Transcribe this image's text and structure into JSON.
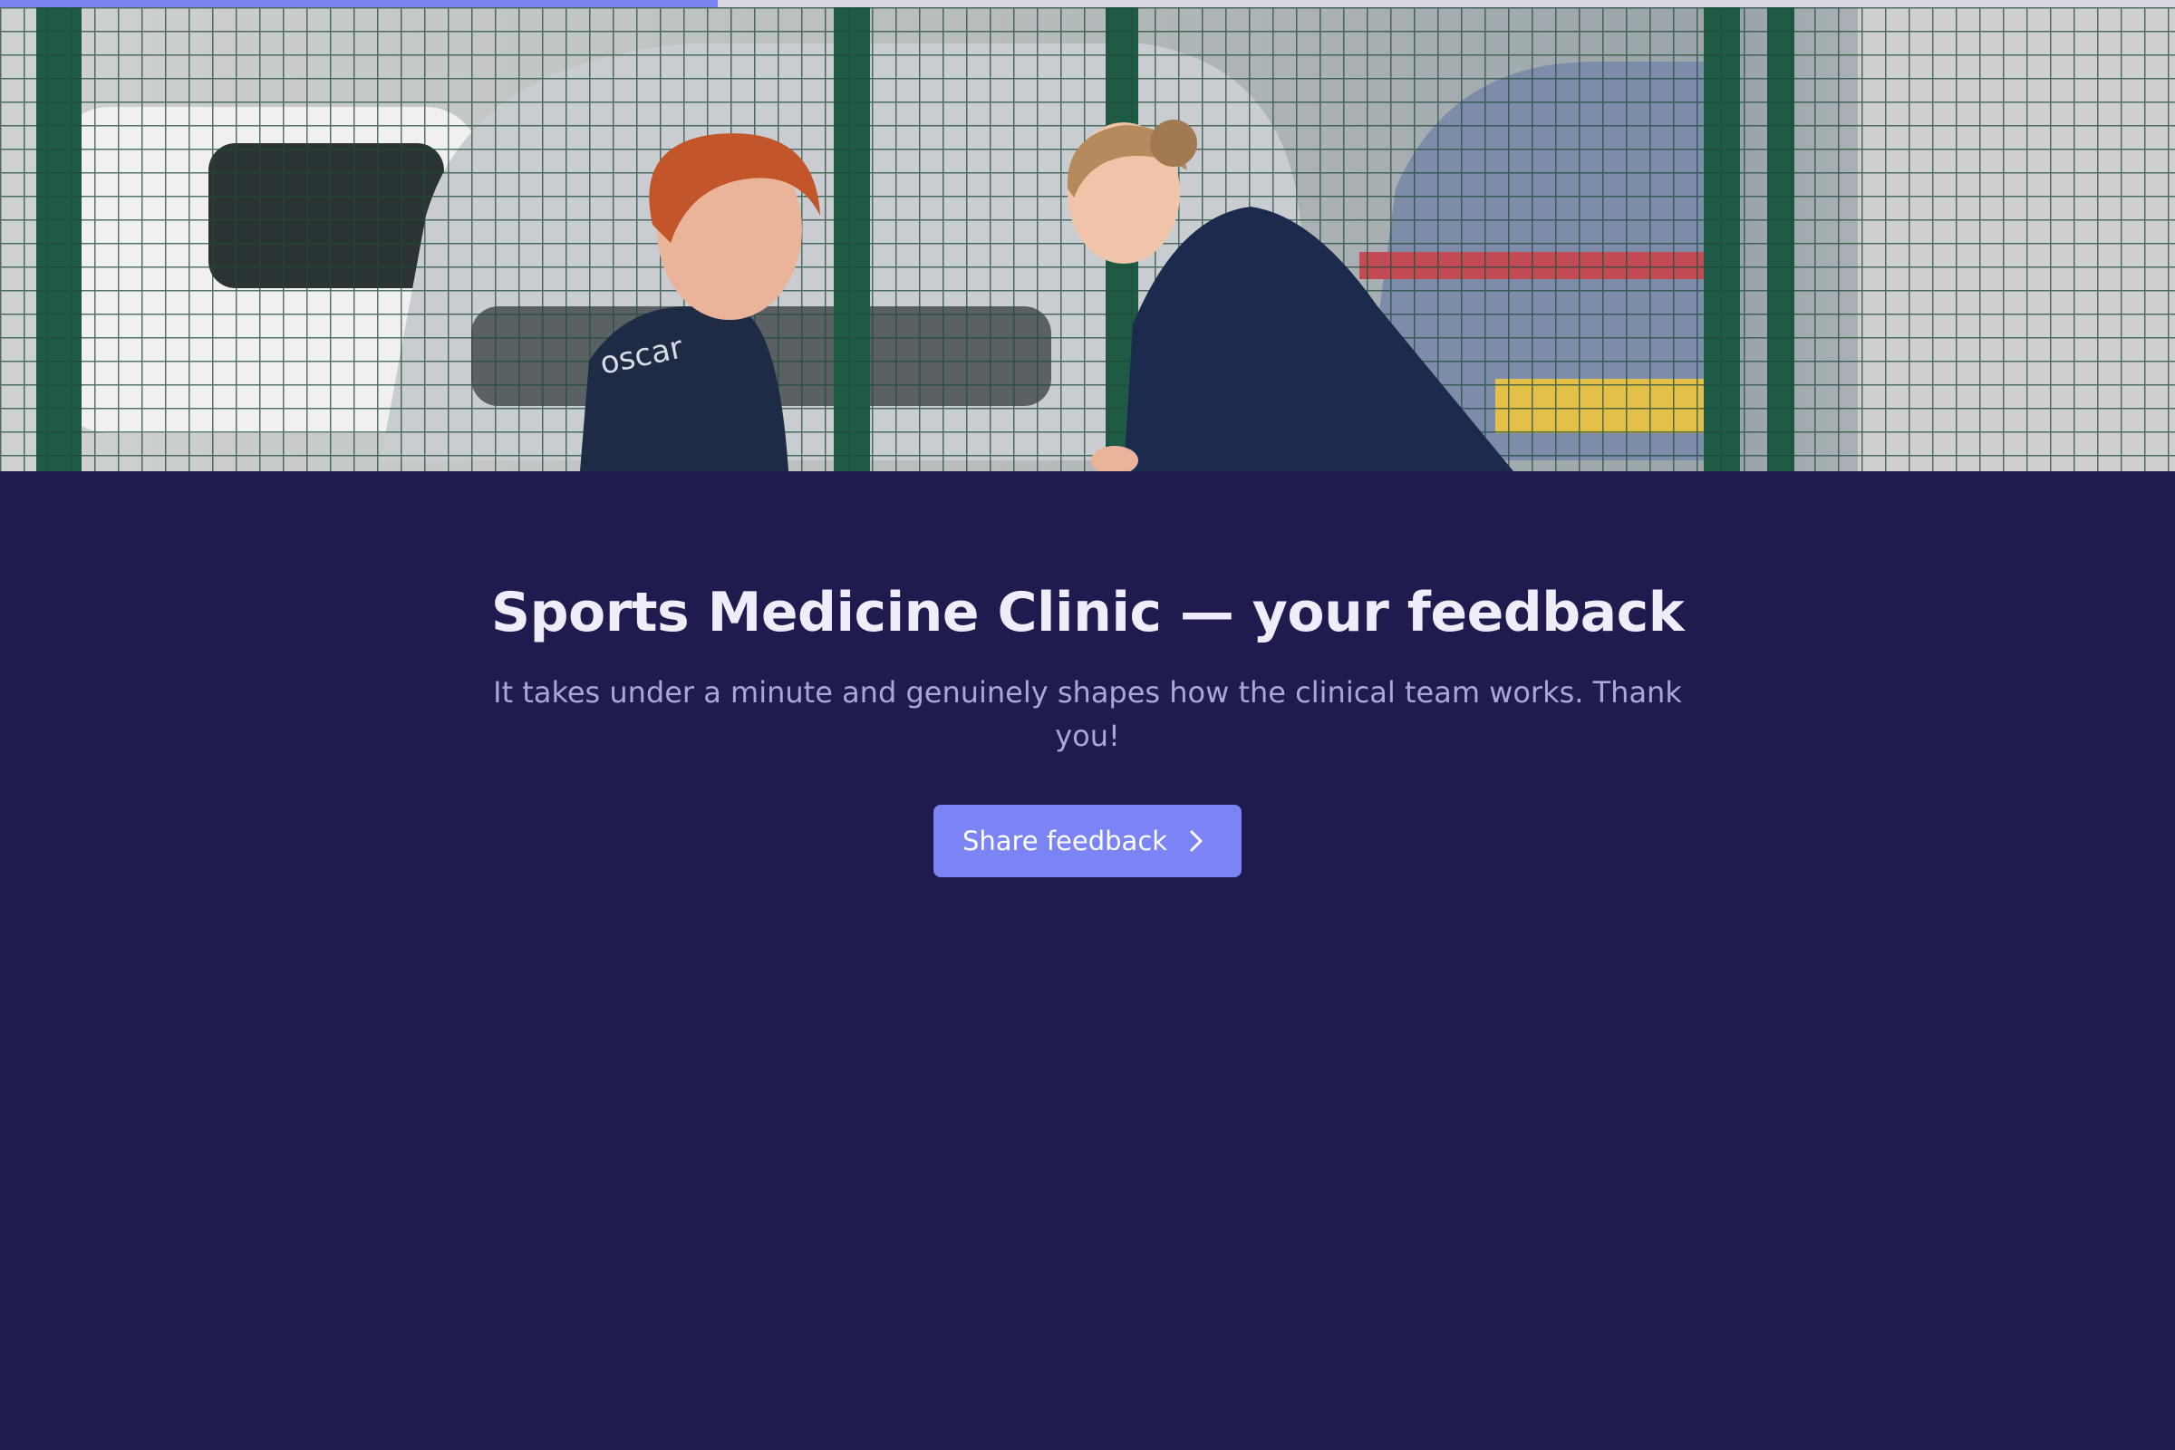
{
  "progress": {
    "fraction": 0.33,
    "fill_color": "#7b83f3"
  },
  "hero": {
    "shirt_text": "oscar",
    "icon": "hero-photo"
  },
  "main": {
    "title": "Sports Medicine Clinic — your feedback",
    "subtitle": "It takes under a minute and genuinely shapes how the clinical team works. Thank you!",
    "cta_label": "Share feedback",
    "cta_icon": "chevron-right-icon"
  },
  "colors": {
    "background": "#1f1b4e",
    "button": "#7a84f4",
    "title": "#eeeefa",
    "subtitle": "#a8a7d6"
  }
}
